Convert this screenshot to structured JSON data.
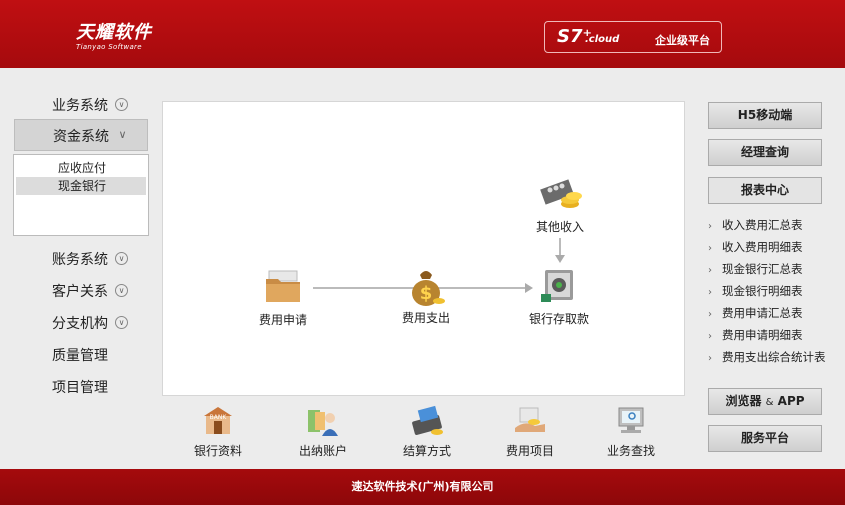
{
  "header": {
    "logo_main": "天耀软件",
    "logo_sub": "Tianyao Software",
    "brand_s7": "S7⁺",
    "brand_cloud": ".cloud",
    "brand_platform": "企业级平台"
  },
  "nav": {
    "items": [
      {
        "label": "业务系统",
        "chevron": "double-down"
      },
      {
        "label": "资金系统",
        "chevron": "double-down"
      },
      {
        "label": "账务系统",
        "chevron": "double-down"
      },
      {
        "label": "客户关系",
        "chevron": "double-down"
      },
      {
        "label": "分支机构",
        "chevron": "double-down"
      },
      {
        "label": "质量管理"
      },
      {
        "label": "项目管理"
      }
    ],
    "sub_items": [
      "应收应付",
      "现金银行"
    ],
    "selected_sub": "现金银行"
  },
  "flow": {
    "nodes": [
      {
        "label": "费用申请",
        "icon": "folder-icon"
      },
      {
        "label": "费用支出",
        "icon": "money-bag-icon"
      },
      {
        "label": "银行存取款",
        "icon": "safe-icon"
      },
      {
        "label": "其他收入",
        "icon": "abacus-coins-icon"
      }
    ]
  },
  "quick_links": [
    {
      "label": "银行资料",
      "icon": "bank-icon"
    },
    {
      "label": "出纳账户",
      "icon": "cashier-icon"
    },
    {
      "label": "结算方式",
      "icon": "card-reader-icon"
    },
    {
      "label": "费用项目",
      "icon": "coin-hand-icon"
    },
    {
      "label": "业务查找",
      "icon": "monitor-search-icon"
    }
  ],
  "right": {
    "h5_button": "H5移动端",
    "manager_button": "经理查询",
    "report_center": "报表中心",
    "reports": [
      "收入费用汇总表",
      "收入费用明细表",
      "现金银行汇总表",
      "现金银行明细表",
      "费用申请汇总表",
      "费用申请明细表",
      "费用支出综合统计表"
    ],
    "browser_button_main": "浏览器",
    "browser_button_amp": "&",
    "browser_button_app": "APP",
    "service_button": "服务平台"
  },
  "footer": {
    "text": "速达软件技术(广州)有限公司"
  },
  "colors": {
    "brand_red": "#c00f12",
    "background": "#ececec"
  }
}
